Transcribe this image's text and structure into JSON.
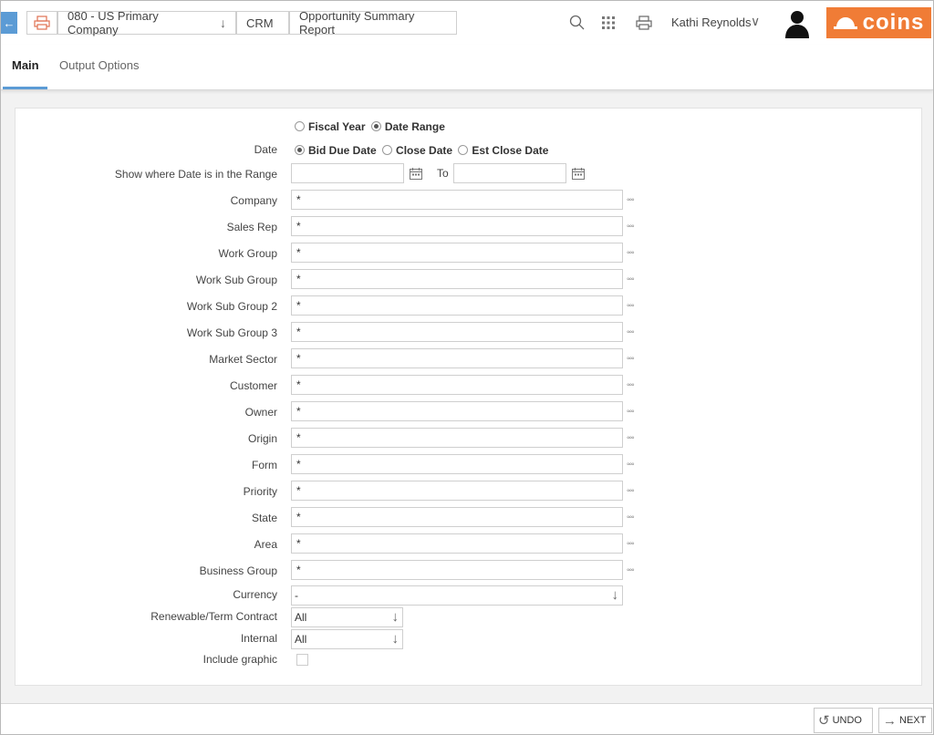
{
  "breadcrumbs": {
    "company": "080 - US Primary Company",
    "module": "CRM",
    "report": "Opportunity Summary Report"
  },
  "user": {
    "name": "Kathi Reynolds"
  },
  "logo": {
    "text": "coins",
    "color": "#f07c36"
  },
  "tabs": [
    {
      "label": "Main",
      "active": true
    },
    {
      "label": "Output Options",
      "active": false
    }
  ],
  "form": {
    "period_options": [
      {
        "label": "Fiscal Year",
        "checked": false
      },
      {
        "label": "Date Range",
        "checked": true
      }
    ],
    "date_label": "Date",
    "date_options": [
      {
        "label": "Bid Due Date",
        "checked": true
      },
      {
        "label": "Close Date",
        "checked": false
      },
      {
        "label": "Est Close Date",
        "checked": false
      }
    ],
    "range_label": "Show where Date is in the Range",
    "range_from": "",
    "range_to_label": "To",
    "range_to": "",
    "fields": [
      {
        "label": "Company",
        "value": "*"
      },
      {
        "label": "Sales Rep",
        "value": "*"
      },
      {
        "label": "Work Group",
        "value": "*"
      },
      {
        "label": "Work Sub Group",
        "value": "*"
      },
      {
        "label": "Work Sub Group 2",
        "value": "*"
      },
      {
        "label": "Work Sub Group 3",
        "value": "*"
      },
      {
        "label": "Market Sector",
        "value": "*"
      },
      {
        "label": "Customer",
        "value": "*"
      },
      {
        "label": "Owner",
        "value": "*"
      },
      {
        "label": "Origin",
        "value": "*"
      },
      {
        "label": "Form",
        "value": "*"
      },
      {
        "label": "Priority",
        "value": "*"
      },
      {
        "label": "State",
        "value": "*"
      },
      {
        "label": "Area",
        "value": "*"
      },
      {
        "label": "Business Group",
        "value": "*"
      }
    ],
    "currency_label": "Currency",
    "currency_value": "-",
    "renewable_label": "Renewable/Term Contract",
    "renewable_value": "All",
    "internal_label": "Internal",
    "internal_value": "All",
    "graphic_label": "Include graphic",
    "graphic_checked": false,
    "lookup_glyph": "◦◦◦"
  },
  "buttons": {
    "undo": "UNDO",
    "next": "NEXT"
  },
  "icons": [
    "back-arrow-icon",
    "printer-icon",
    "search-icon",
    "apps-grid-icon",
    "chevron-down-icon",
    "avatar-icon",
    "calendar-icon",
    "lookup-dots-icon",
    "undo-icon",
    "arrow-right-icon"
  ]
}
